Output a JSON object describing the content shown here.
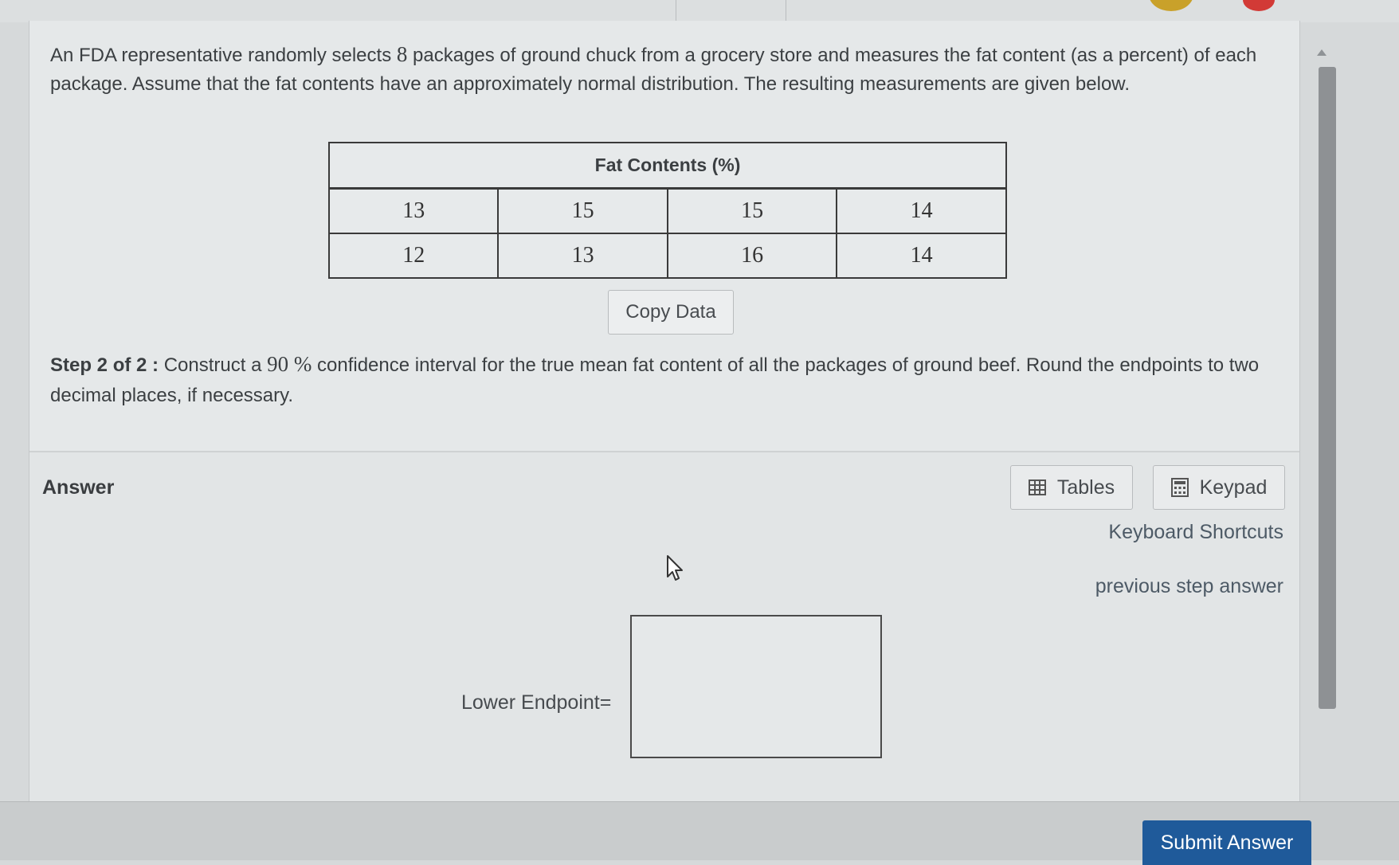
{
  "problem": {
    "text_before": "An FDA representative randomly selects ",
    "sample_size": "8",
    "text_after": " packages of ground chuck from a grocery store and measures the fat content (as a percent) of each package. Assume that the fat contents have an approximately normal distribution. The resulting measurements are given below."
  },
  "table": {
    "header": "Fat Contents (%)",
    "rows": [
      [
        "13",
        "15",
        "15",
        "14"
      ],
      [
        "12",
        "13",
        "16",
        "14"
      ]
    ]
  },
  "copy_data_label": "Copy Data",
  "step": {
    "label": "Step 2 of 2 :",
    "text_before": " Construct a ",
    "confidence": "90 %",
    "text_after": " confidence interval for the true mean fat content of all the packages of ground beef. Round the endpoints to two decimal places, if necessary."
  },
  "answer": {
    "label": "Answer",
    "tables_label": "Tables",
    "keypad_label": "Keypad",
    "keyboard_shortcuts": "Keyboard Shortcuts",
    "previous_step": "previous step answer",
    "lower_endpoint_label": "Lower Endpoint=",
    "lower_endpoint_value": ""
  },
  "submit_label": "Submit Answer",
  "colors": {
    "submit_bg": "#1f5a9a",
    "panel_bg": "#e3e6e7",
    "link": "#4d5a66"
  },
  "icons": {
    "tables": "table-grid-icon",
    "keypad": "calculator-icon",
    "cursor": "mouse-pointer-icon"
  }
}
